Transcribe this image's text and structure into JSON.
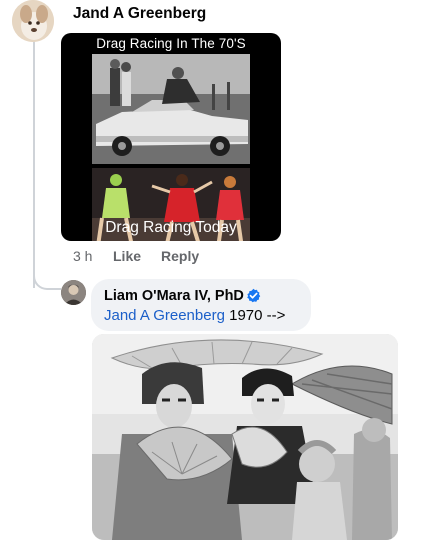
{
  "comment": {
    "author": "Jand A Greenberg",
    "avatar_icon": "dog-photo-avatar",
    "meme": {
      "top_caption": "Drag Racing In The 70'S",
      "bottom_caption": "Drag Racing Today"
    },
    "actions": {
      "time": "3 h",
      "like_label": "Like",
      "reply_label": "Reply"
    }
  },
  "reply": {
    "author": "Liam O'Mara IV, PhD",
    "verified_icon": "verified-badge-icon",
    "mention": "Jand A Greenberg",
    "text": " 1970 -->",
    "avatar_icon": "person-photo-avatar",
    "photo_icon": "vintage-drag-photo"
  },
  "colors": {
    "mention": "#1b5fc9",
    "secondary_text": "#65676b",
    "bubble_bg": "#f0f2f5",
    "verified": "#1877f2"
  }
}
